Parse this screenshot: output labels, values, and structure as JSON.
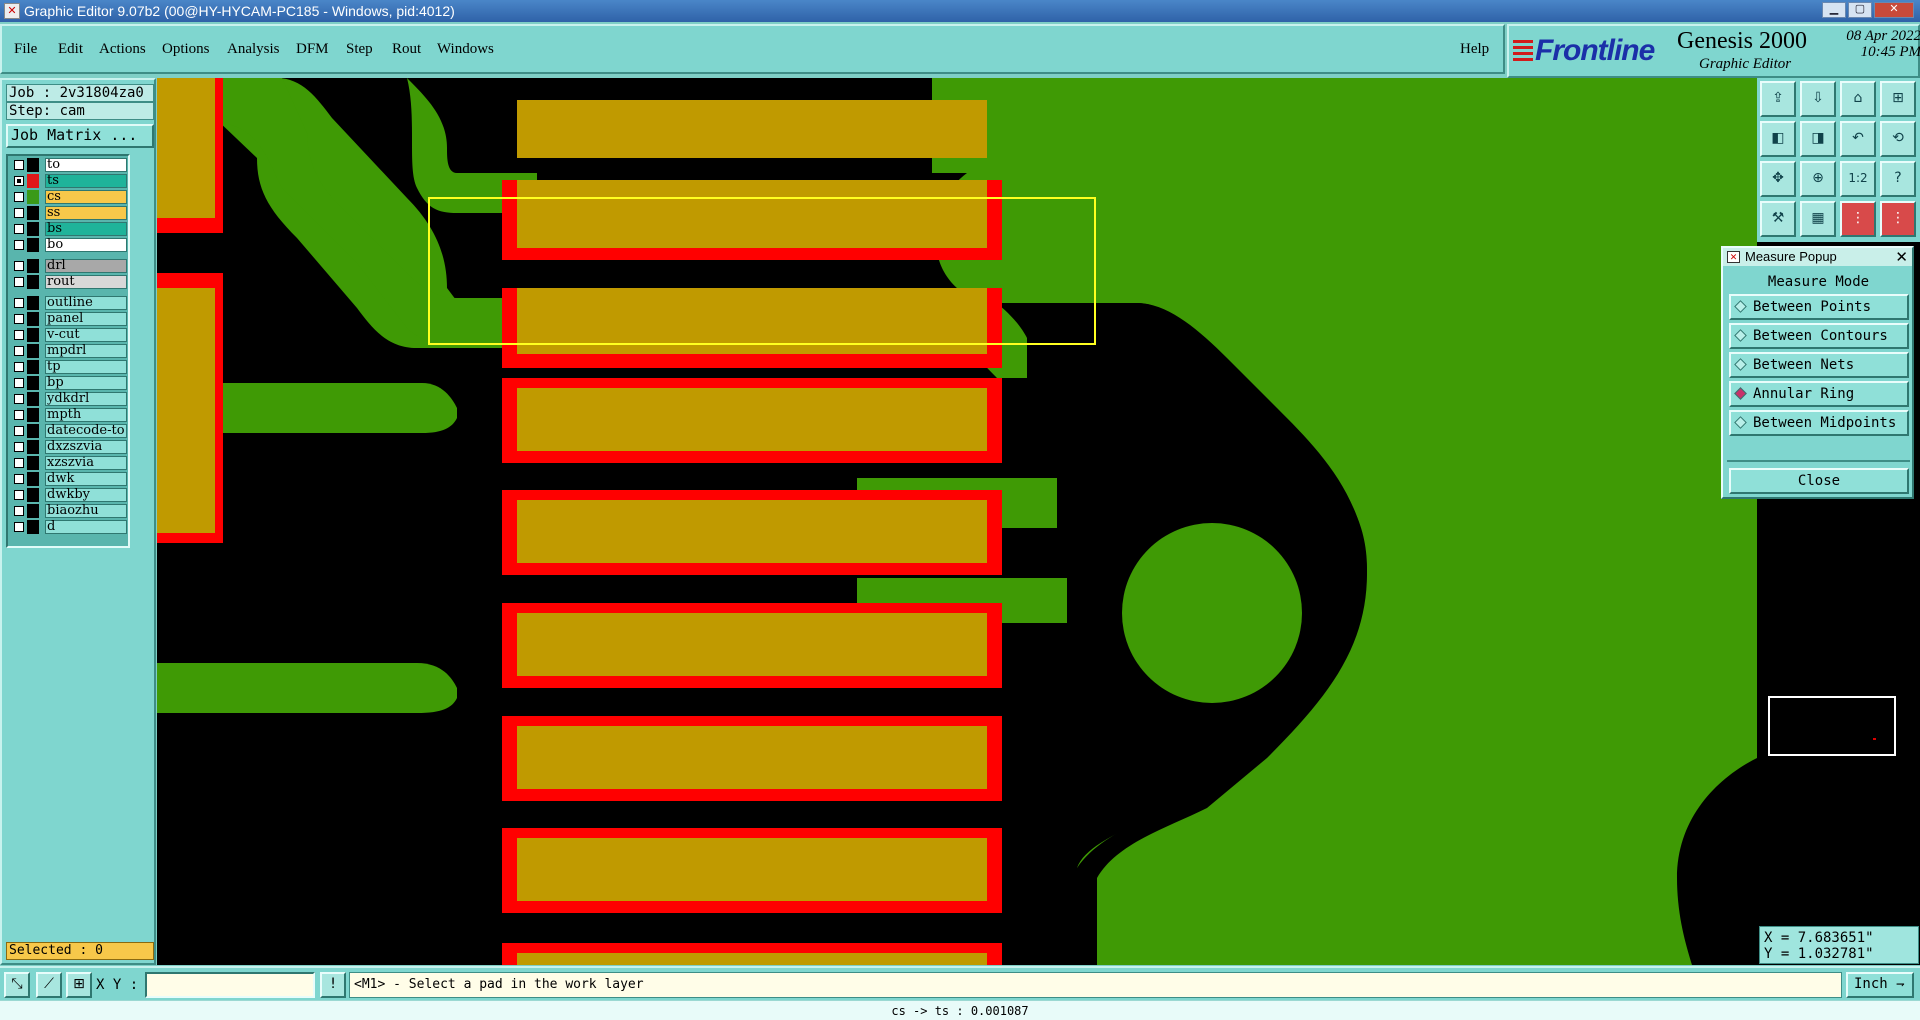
{
  "window": {
    "title": "Graphic Editor 9.07b2 (00@HY-HYCAM-PC185 - Windows, pid:4012)"
  },
  "menu": {
    "items": [
      "File",
      "Edit",
      "Actions",
      "Options",
      "Analysis",
      "DFM",
      "Step",
      "Rout",
      "Windows"
    ],
    "help": "Help"
  },
  "brand": {
    "logo": "Frontline",
    "product": "Genesis 2000",
    "subtitle": "Graphic Editor",
    "date": "08 Apr 2022",
    "time": "10:45 PM"
  },
  "job": {
    "job_label": "Job : 2v31804za0",
    "step_label": "Step: cam",
    "matrix_button": "Job Matrix ..."
  },
  "layers": [
    {
      "name": "to",
      "color": "#ffffff",
      "swatch": "#000000",
      "checked": false
    },
    {
      "name": "ts",
      "color": "#1fb39a",
      "swatch": "#e01818",
      "checked": true,
      "work": true
    },
    {
      "name": "cs",
      "color": "#f7c84a",
      "swatch": "#3a9a18",
      "checked": false
    },
    {
      "name": "ss",
      "color": "#f7c84a",
      "swatch": "#000000",
      "checked": false
    },
    {
      "name": "bs",
      "color": "#1fb39a",
      "swatch": "#000000",
      "checked": false
    },
    {
      "name": "bo",
      "color": "#ffffff",
      "swatch": "#000000",
      "checked": false
    },
    {
      "name": "drl",
      "color": "#a8a8a8",
      "swatch": "#000000",
      "checked": false
    },
    {
      "name": "rout",
      "color": "#d8d8d8",
      "swatch": "#000000",
      "checked": false
    },
    {
      "name": "outline",
      "color": "#8fe0d8",
      "swatch": "#000000",
      "checked": false
    },
    {
      "name": "panel",
      "color": "#8fe0d8",
      "swatch": "#000000",
      "checked": false
    },
    {
      "name": "v-cut",
      "color": "#8fe0d8",
      "swatch": "#000000",
      "checked": false
    },
    {
      "name": "mpdrl",
      "color": "#8fe0d8",
      "swatch": "#000000",
      "checked": false
    },
    {
      "name": "tp",
      "color": "#8fe0d8",
      "swatch": "#000000",
      "checked": false
    },
    {
      "name": "bp",
      "color": "#8fe0d8",
      "swatch": "#000000",
      "checked": false
    },
    {
      "name": "ydkdrl",
      "color": "#8fe0d8",
      "swatch": "#000000",
      "checked": false
    },
    {
      "name": "mpth",
      "color": "#8fe0d8",
      "swatch": "#000000",
      "checked": false
    },
    {
      "name": "datecode-to",
      "color": "#8fe0d8",
      "swatch": "#000000",
      "checked": false
    },
    {
      "name": "dxzszvia",
      "color": "#8fe0d8",
      "swatch": "#000000",
      "checked": false
    },
    {
      "name": "xzszvia",
      "color": "#8fe0d8",
      "swatch": "#000000",
      "checked": false
    },
    {
      "name": "dwk",
      "color": "#8fe0d8",
      "swatch": "#000000",
      "checked": false
    },
    {
      "name": "dwkby",
      "color": "#8fe0d8",
      "swatch": "#000000",
      "checked": false
    },
    {
      "name": "biaozhu",
      "color": "#8fe0d8",
      "swatch": "#000000",
      "checked": false
    },
    {
      "name": "d",
      "color": "#8fe0d8",
      "swatch": "#000000",
      "checked": false
    }
  ],
  "selected": "Selected : 0",
  "measure_popup": {
    "title": "Measure Popup",
    "mode_title": "Measure Mode",
    "options": [
      {
        "label": "Between Points",
        "selected": false
      },
      {
        "label": "Between Contours",
        "selected": false
      },
      {
        "label": "Between Nets",
        "selected": false
      },
      {
        "label": "Annular Ring",
        "selected": true
      },
      {
        "label": "Between Midpoints",
        "selected": false
      }
    ],
    "close": "Close"
  },
  "coords": {
    "x": "X = 7.683651\"",
    "y": "Y = 1.032781\""
  },
  "bottom": {
    "xy_label": "X Y :",
    "xy_value": "",
    "prompt": "<M1> - Select a pad in the work layer",
    "units": "Inch"
  },
  "status_line": "cs -> ts : 0.001087",
  "colors": {
    "canvas_bg": "#000000",
    "copper": "#3f9a05",
    "pad": "#c09a00",
    "mask": "#ff0000",
    "highlight": "#ffff20",
    "panel_bg": "#7fd6cf"
  },
  "icons": [
    "zoom-home-icon",
    "zoom-fit-icon",
    "pan-icon",
    "measure-icon",
    "ruler-icon",
    "grid-icon",
    "snap-icon",
    "help-icon"
  ]
}
